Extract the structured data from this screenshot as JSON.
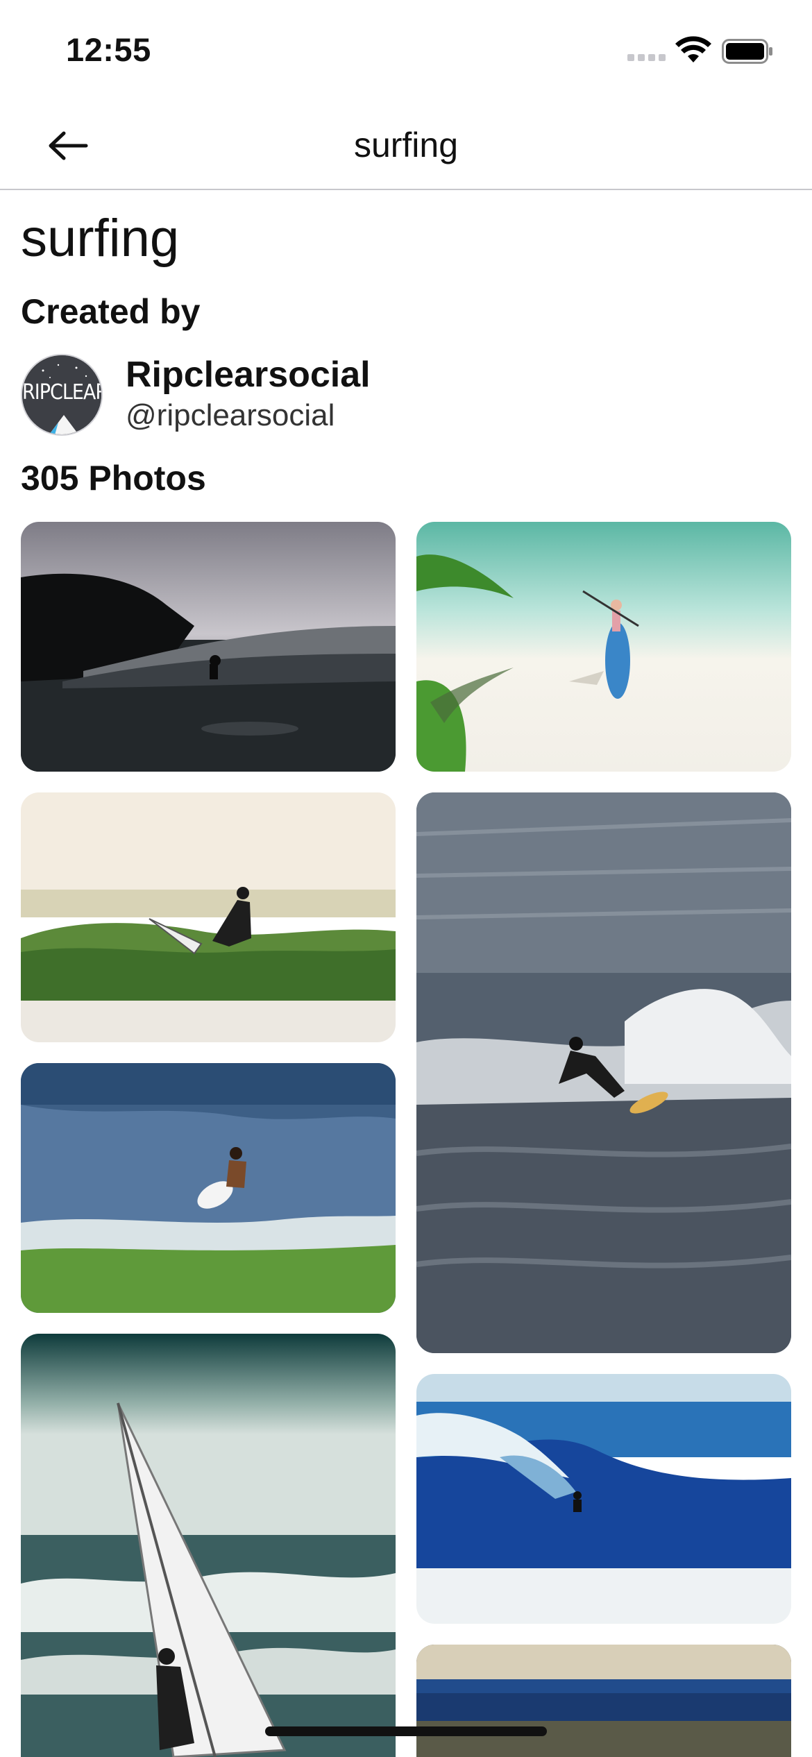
{
  "status_bar": {
    "time": "12:55"
  },
  "nav": {
    "title": "surfing",
    "back_icon": "arrow-left-icon"
  },
  "collection": {
    "title": "surfing",
    "created_by_label": "Created by",
    "author_name": "Ripclearsocial",
    "author_handle": "@ripclearsocial",
    "avatar_text": "RIPCLEAR",
    "photo_count": "305 Photos"
  },
  "photos": [
    {
      "subject": "surfer silhouette at dusk by headland"
    },
    {
      "subject": "aerial paddleboarder on beach"
    },
    {
      "subject": "surfer riding green wave"
    },
    {
      "subject": "surfer carving white water"
    },
    {
      "subject": "surfer aerial over wave"
    },
    {
      "subject": "windsurfer in surf"
    },
    {
      "subject": "surfer in blue barrel wave"
    },
    {
      "subject": "aerial ocean shoreline"
    }
  ]
}
